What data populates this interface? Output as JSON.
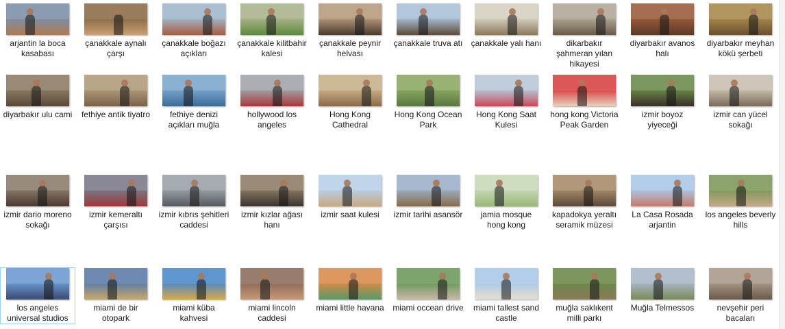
{
  "files": [
    {
      "name": "arjantin la boca kasabası",
      "thumb": [
        "#7b8fa8",
        "#b07a52"
      ]
    },
    {
      "name": "çanakkale aynalı çarşı",
      "thumb": [
        "#8a6a48",
        "#c9a070"
      ]
    },
    {
      "name": "çanakkale boğazı açıkları",
      "thumb": [
        "#9fb8cc",
        "#a85a40"
      ]
    },
    {
      "name": "çanakkale kilitbahir kalesi",
      "thumb": [
        "#a9b38a",
        "#5f8a3c"
      ]
    },
    {
      "name": "çanakkale peynir helvası",
      "thumb": [
        "#b59a7a",
        "#4a3a2e"
      ]
    },
    {
      "name": "çanakkale truva atı",
      "thumb": [
        "#a8c0d8",
        "#5d4a36"
      ]
    },
    {
      "name": "çanakkale yalı hanı",
      "thumb": [
        "#d6d0c0",
        "#8a7a5c"
      ]
    },
    {
      "name": "dikarbakır şahmeran yılan hikayesi",
      "thumb": [
        "#b0a898",
        "#6b5a48"
      ]
    },
    {
      "name": "diyarbakır avanos halı",
      "thumb": [
        "#9a5a38",
        "#5a3a28"
      ]
    },
    {
      "name": "diyarbakır meyhan kökü şerbeti",
      "thumb": [
        "#a8884a",
        "#6a5030"
      ]
    },
    {
      "name": "diyarbakır ulu cami",
      "thumb": [
        "#8c7a62",
        "#5a4a3a"
      ]
    },
    {
      "name": "fethiye antik tiyatro",
      "thumb": [
        "#b09a78",
        "#7a6248"
      ]
    },
    {
      "name": "fethiye denizi açıkları muğla",
      "thumb": [
        "#7aa6cc",
        "#3a6a9a"
      ]
    },
    {
      "name": "hollywood los angeles",
      "thumb": [
        "#a0a4aa",
        "#a83838"
      ]
    },
    {
      "name": "Hong Kong Cathedral",
      "thumb": [
        "#c8b088",
        "#8a6a48"
      ]
    },
    {
      "name": "Hong Kong Ocean Park",
      "thumb": [
        "#8aa860",
        "#5a7840"
      ]
    },
    {
      "name": "Hong Kong Saat Kulesi",
      "thumb": [
        "#b8c8d8",
        "#c84a5a"
      ]
    },
    {
      "name": "hong kong Victoria Peak Garden",
      "thumb": [
        "#d84040",
        "#e8d0c0"
      ]
    },
    {
      "name": "izmir boyoz yiyeceği",
      "thumb": [
        "#6a8a48",
        "#3a3028"
      ]
    },
    {
      "name": "izmir can yücel sokağı",
      "thumb": [
        "#c8c0b0",
        "#7a6a58"
      ]
    },
    {
      "name": "izmir dario moreno sokağı",
      "thumb": [
        "#8a7a6a",
        "#4a3a30"
      ]
    },
    {
      "name": "izmir kemeraltı çarşısı",
      "thumb": [
        "#7a7888",
        "#9a3a38"
      ]
    },
    {
      "name": "izmir kıbrıs şehitleri caddesi",
      "thumb": [
        "#9aa0a8",
        "#585a60"
      ]
    },
    {
      "name": "izmir kızlar ağası hanı",
      "thumb": [
        "#8a7a62",
        "#3a3430"
      ]
    },
    {
      "name": "izmir saat kulesi",
      "thumb": [
        "#b8d0e8",
        "#c8a880"
      ]
    },
    {
      "name": "izmir tarihi asansör",
      "thumb": [
        "#9ab0c8",
        "#8a6a48"
      ]
    },
    {
      "name": "jamia mosque hong kong",
      "thumb": [
        "#c8d8b8",
        "#9ab878"
      ]
    },
    {
      "name": "kapadokya yeraltı seramik müzesi",
      "thumb": [
        "#a88a68",
        "#5a4a3a"
      ]
    },
    {
      "name": "La Casa Rosada arjantin",
      "thumb": [
        "#a8c8e8",
        "#c87a6a"
      ]
    },
    {
      "name": "los angeles beverly hills",
      "thumb": [
        "#7a9858",
        "#c8a888"
      ]
    },
    {
      "name": "los angeles universal studios",
      "thumb": [
        "#6a98d0",
        "#3a4a70"
      ]
    },
    {
      "name": "miami de bir otopark",
      "thumb": [
        "#5a7aa8",
        "#c8a868"
      ]
    },
    {
      "name": "miami küba kahvesi",
      "thumb": [
        "#4a88c8",
        "#d8a848"
      ]
    },
    {
      "name": "miami lincoln caddesi",
      "thumb": [
        "#8a6a58",
        "#c89878"
      ]
    },
    {
      "name": "miami little havana",
      "thumb": [
        "#d88a48",
        "#5a9868"
      ]
    },
    {
      "name": "miami occean drive",
      "thumb": [
        "#6a9858",
        "#c8b8a8"
      ]
    },
    {
      "name": "miami tallest sand castle",
      "thumb": [
        "#a8c8e8",
        "#e8e0d0"
      ]
    },
    {
      "name": "muğla saklıkent milli parkı",
      "thumb": [
        "#6a8848",
        "#8a7a5a"
      ]
    },
    {
      "name": "Muğla Telmessos",
      "thumb": [
        "#a8b8c8",
        "#7a8a58"
      ]
    },
    {
      "name": "nevşehir peri bacaları",
      "thumb": [
        "#a89888",
        "#6a5a4a"
      ]
    }
  ],
  "selected_index": 30
}
